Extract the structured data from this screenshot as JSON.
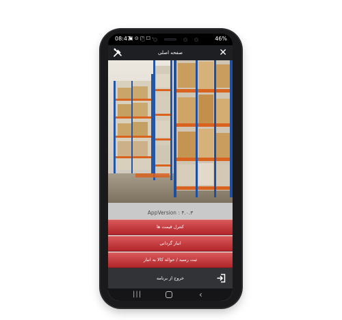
{
  "status_bar": {
    "time": "08:47",
    "icons": "▣ ⊙ ◫ ☐ ⋅",
    "battery": "46%"
  },
  "app_bar": {
    "title": "صفحه اصلی",
    "close_glyph": "✕"
  },
  "menu": {
    "version": "AppVersion : ۴.۰.۳",
    "items": [
      {
        "label": "کنترل قیمت ها"
      },
      {
        "label": "انبار گردانی"
      },
      {
        "label": "ثبت رسید / حواله کالا به انبار"
      }
    ],
    "exit_label": "خروج از برنامه"
  },
  "nav": {
    "recent_glyph": "|||",
    "back_glyph": "‹"
  },
  "colors": {
    "accent_red": "#c0393c",
    "app_bar": "#1e1f23",
    "menu_bg": "#c9c9c9"
  }
}
